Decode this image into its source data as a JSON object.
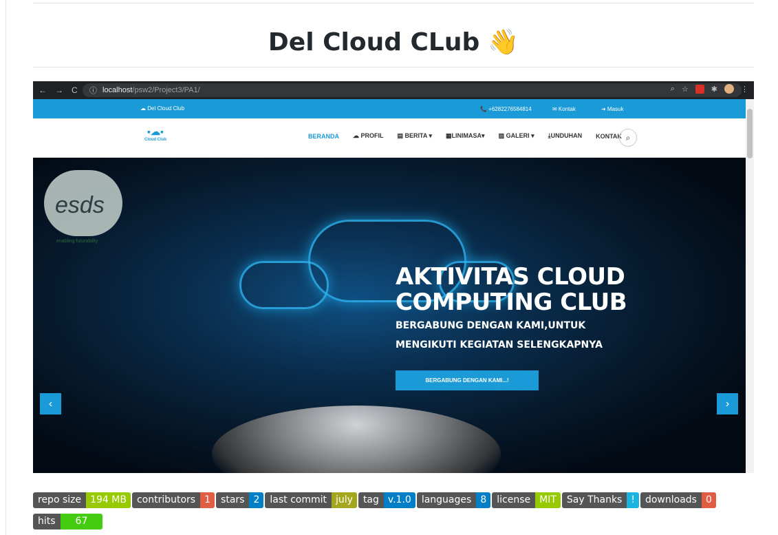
{
  "page": {
    "title": "Del Cloud CLub",
    "title_emoji": "👋"
  },
  "browser": {
    "nav_back": "←",
    "nav_forward": "→",
    "nav_reload": "C",
    "info_icon": "ⓘ",
    "url_host": "localhost",
    "url_path": "/psw2/Project3/PA1/",
    "right_icons": [
      "zoom-icon",
      "star-icon",
      "extension-icon",
      "puzzle-icon",
      "avatar-icon",
      "menu-icon"
    ]
  },
  "site": {
    "topbar": {
      "brand": "☁ Del Cloud Club",
      "phone": "📞 +6282276584814",
      "kontak": "✉ Kontak",
      "masuk": "➜ Masuk"
    },
    "logo_text": "Cloud Club",
    "menu": [
      {
        "label": "BERANDA",
        "active": true
      },
      {
        "label": "☁ PROFIL"
      },
      {
        "label": "▤ BERITA ▾"
      },
      {
        "label": "▦LINIMASA▾"
      },
      {
        "label": "▨ GALERI ▾"
      },
      {
        "label": "⤓UNDUHAN"
      },
      {
        "label": "KONTAK"
      }
    ],
    "hero": {
      "logo_text": "esds",
      "logo_tag": "enabling futurability",
      "title_line1": "AKTIVITAS CLOUD",
      "title_line2": "COMPUTING CLUB",
      "subtitle": "BERGABUNG DENGAN KAMI,UNTUK MENGIKUTI KEGIATAN SELENGKAPNYA",
      "button": "BERGABUNG DENGAN KAMI...!",
      "prev": "‹",
      "next": "›"
    }
  },
  "badges": [
    {
      "label": "repo size",
      "value": "194 MB",
      "color": "#97ca00"
    },
    {
      "label": "contributors",
      "value": "1",
      "color": "#e05d44"
    },
    {
      "label": "stars",
      "value": "2",
      "color": "#007ec6"
    },
    {
      "label": "last commit",
      "value": "july",
      "color": "#a4a61d"
    },
    {
      "label": "tag",
      "value": "v.1.0",
      "color": "#007ec6"
    },
    {
      "label": "languages",
      "value": "8",
      "color": "#007ec6"
    },
    {
      "label": "license",
      "value": "MIT",
      "color": "#97ca00"
    },
    {
      "label": "Say Thanks",
      "value": "!",
      "color": "#1bb3e0"
    },
    {
      "label": "downloads",
      "value": "0",
      "color": "#e05d44"
    },
    {
      "label": "hits",
      "value": "67",
      "color": "#4c1"
    }
  ]
}
